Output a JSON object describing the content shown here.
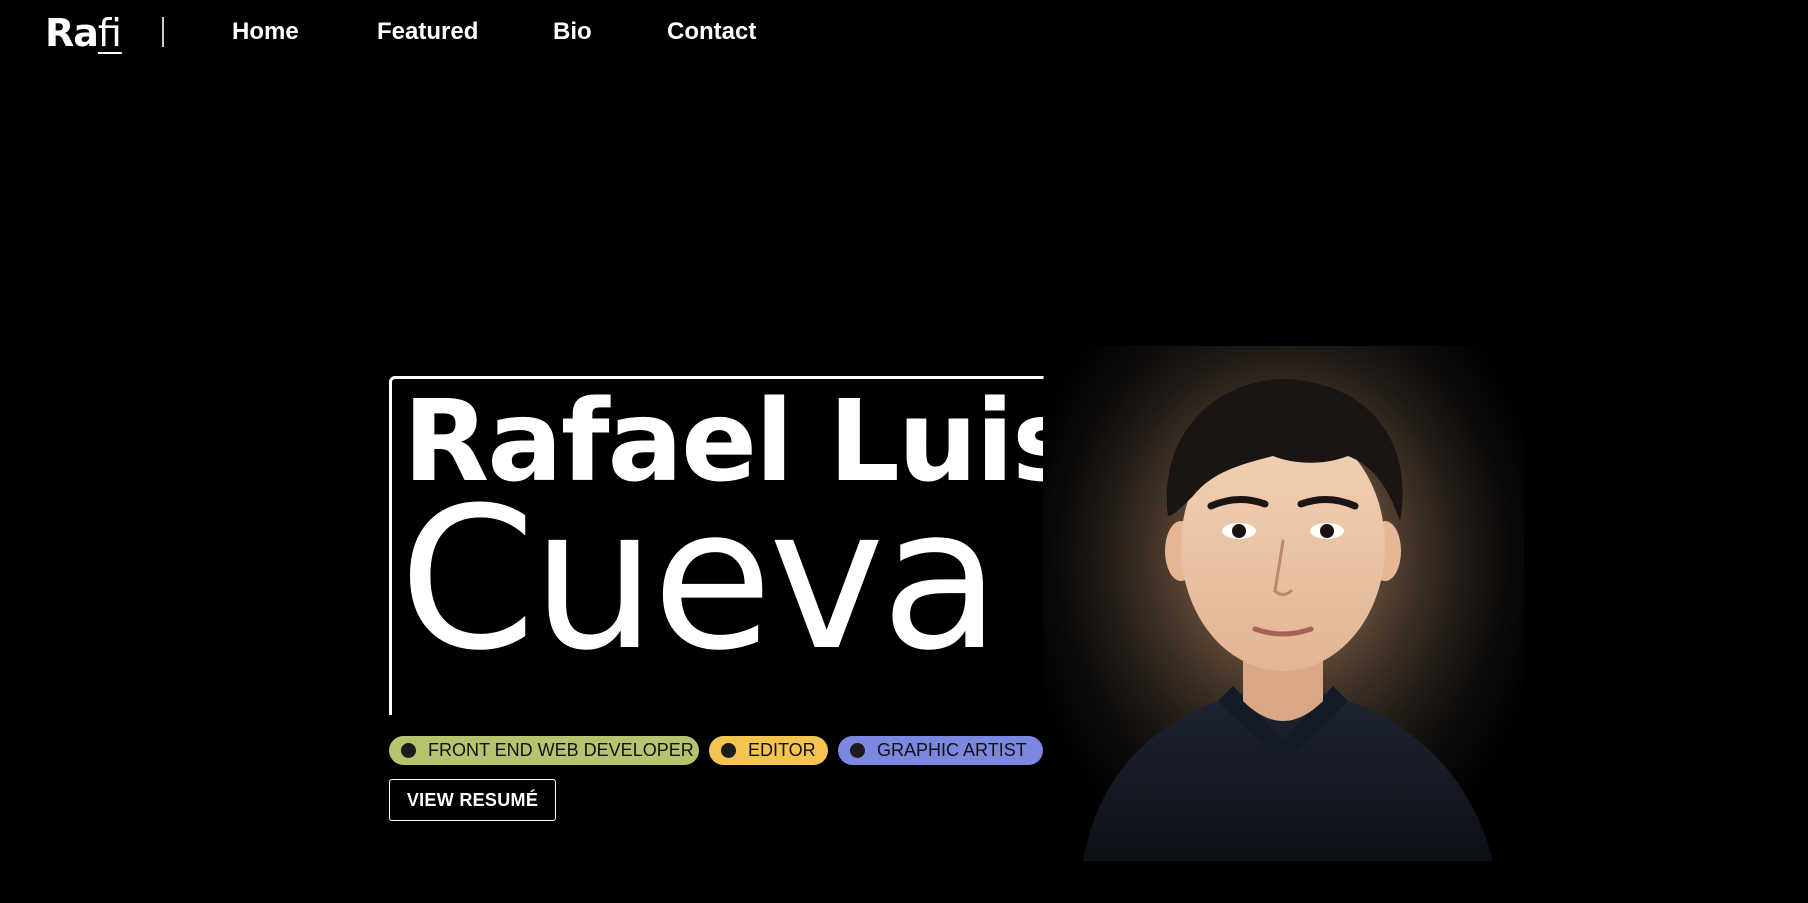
{
  "nav": {
    "logo_bold": "Ra",
    "logo_light": "fi",
    "links": [
      {
        "label": "Home"
      },
      {
        "label": "Featured"
      },
      {
        "label": "Bio"
      },
      {
        "label": "Contact"
      }
    ]
  },
  "hero": {
    "first_name": "Rafael Luis",
    "last_name": "Cueva",
    "tags": [
      {
        "label": "FRONT END WEB DEVELOPER",
        "color": "#b7c46f"
      },
      {
        "label": "EDITOR",
        "color": "#f3c44f"
      },
      {
        "label": "GRAPHIC ARTIST",
        "color": "#7c88e0"
      }
    ],
    "resume_label": "VIEW RESUMÉ"
  },
  "portrait": {
    "icon": "portrait-photo"
  },
  "colors": {
    "background": "#000000",
    "text": "#ffffff"
  }
}
